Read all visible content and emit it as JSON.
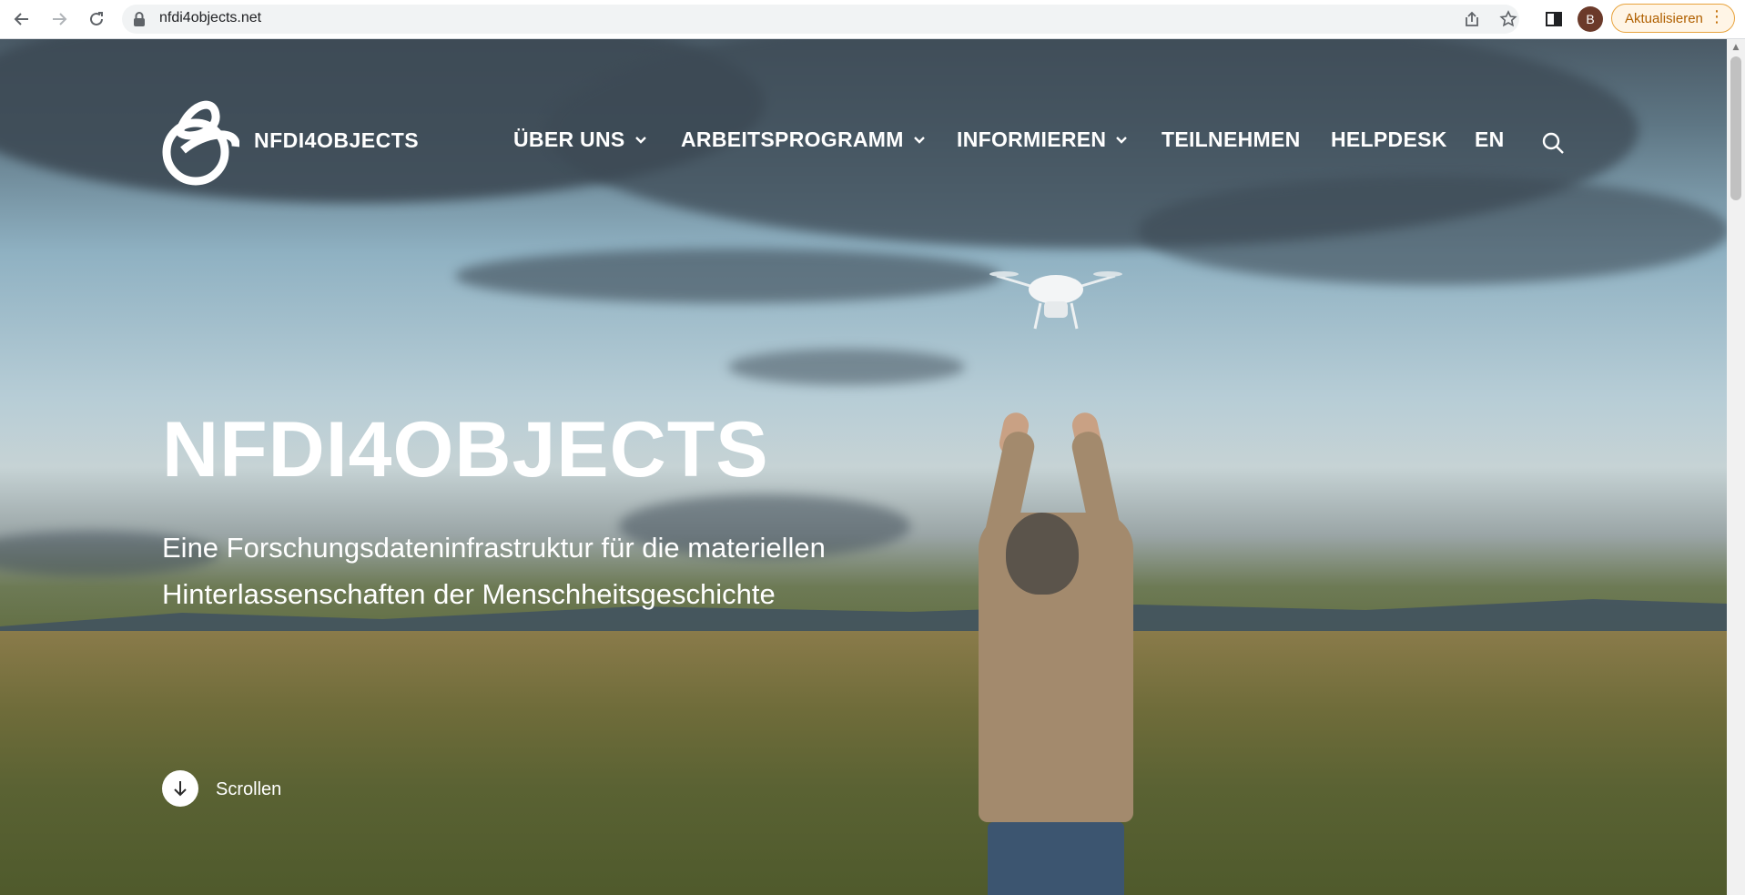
{
  "browser": {
    "url": "nfdi4objects.net",
    "profile_initial": "B",
    "update_label": "Aktualisieren",
    "accent_color": "#e8a33d"
  },
  "site": {
    "brand": "NFDI4OBJECTS",
    "nav": [
      {
        "label": "ÜBER UNS",
        "has_dropdown": true
      },
      {
        "label": "ARBEITSPROGRAMM",
        "has_dropdown": true
      },
      {
        "label": "INFORMIEREN",
        "has_dropdown": true
      },
      {
        "label": "TEILNEHMEN",
        "has_dropdown": false
      },
      {
        "label": "HELPDESK",
        "has_dropdown": false
      },
      {
        "label": "EN",
        "has_dropdown": false
      }
    ]
  },
  "hero": {
    "title": "NFDI4OBJECTS",
    "subtitle_line1": "Eine Forschungsdateninfrastruktur für die materiellen",
    "subtitle_line2": "Hinterlassenschaften der Menschheitsgeschichte",
    "scroll_label": "Scrollen"
  },
  "icons": {
    "back": "arrow-left",
    "forward": "arrow-right",
    "reload": "reload",
    "lock": "lock",
    "share": "share",
    "bookmark": "star",
    "side_panel": "side-panel",
    "search": "magnifier",
    "scroll": "arrow-down-circle"
  }
}
